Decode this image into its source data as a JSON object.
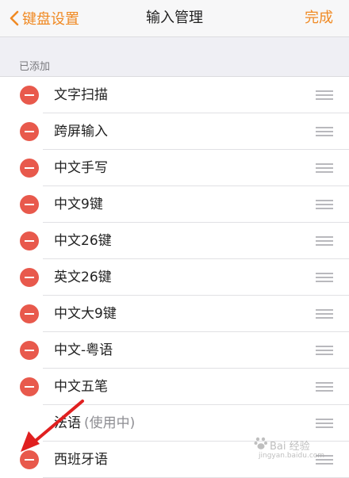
{
  "header": {
    "back_label": "键盘设置",
    "title": "输入管理",
    "done_label": "完成"
  },
  "section_header": "已添加",
  "rows": [
    {
      "label": "文字扫描",
      "status": "",
      "deletable": true
    },
    {
      "label": "跨屏输入",
      "status": "",
      "deletable": true
    },
    {
      "label": "中文手写",
      "status": "",
      "deletable": true
    },
    {
      "label": "中文9键",
      "status": "",
      "deletable": true
    },
    {
      "label": "中文26键",
      "status": "",
      "deletable": true
    },
    {
      "label": "英文26键",
      "status": "",
      "deletable": true
    },
    {
      "label": "中文大9键",
      "status": "",
      "deletable": true
    },
    {
      "label": "中文-粤语",
      "status": "",
      "deletable": true
    },
    {
      "label": "中文五笔",
      "status": "",
      "deletable": true
    },
    {
      "label": "法语",
      "status": "(使用中)",
      "deletable": false
    },
    {
      "label": "西班牙语",
      "status": "",
      "deletable": true
    }
  ],
  "watermark": {
    "text": "Bai 经验",
    "url": "jingyan.baidu.com"
  },
  "colors": {
    "accent": "#f08a24",
    "delete": "#e8594c",
    "arrow": "#e02020"
  }
}
